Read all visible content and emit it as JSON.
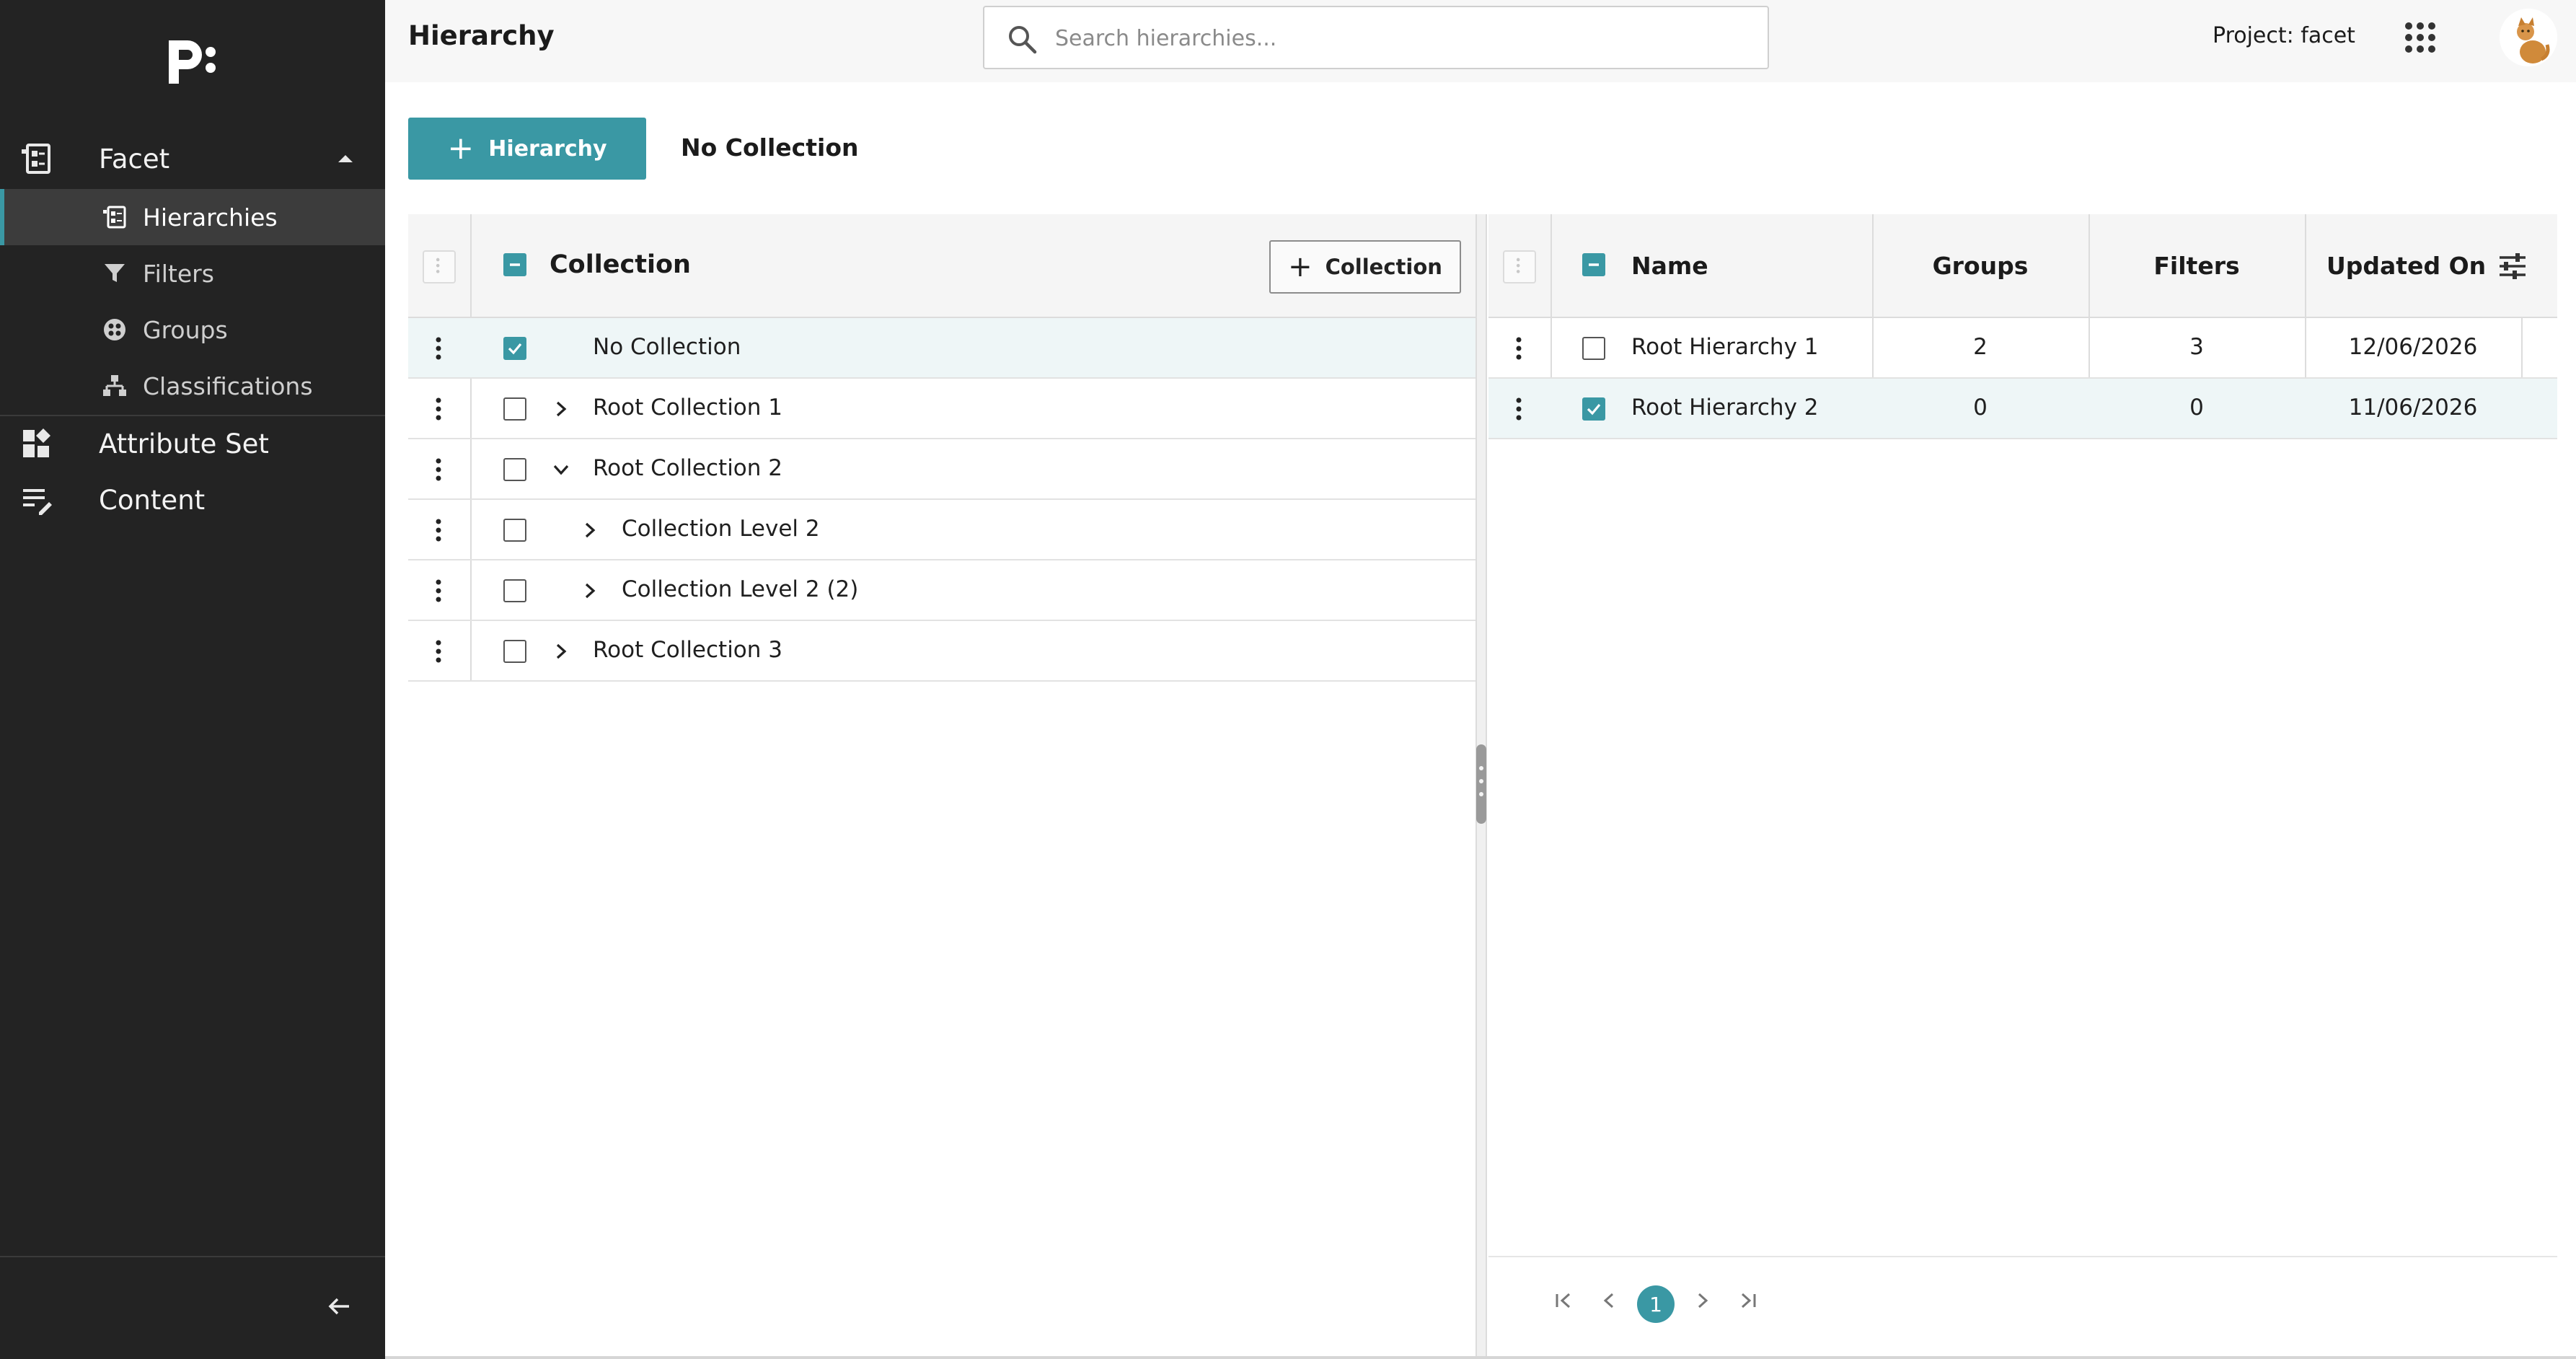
{
  "app": {
    "page_title": "Hierarchy",
    "project_label": "Project: facet",
    "accent_color": "#3a98a4"
  },
  "search": {
    "placeholder": "Search hierarchies..."
  },
  "sidebar": {
    "sections": [
      {
        "label": "Facet",
        "icon": "hierarchy-doc-icon",
        "expanded": true
      },
      {
        "label": "Attribute Set",
        "icon": "dashboard-add-icon"
      },
      {
        "label": "Content",
        "icon": "edit-list-icon"
      }
    ],
    "facet_items": [
      {
        "label": "Hierarchies",
        "icon": "hierarchy-doc-icon",
        "active": true
      },
      {
        "label": "Filters",
        "icon": "filter-icon"
      },
      {
        "label": "Groups",
        "icon": "groups-icon"
      },
      {
        "label": "Classifications",
        "icon": "classification-icon"
      }
    ]
  },
  "toolbar": {
    "add_hierarchy_label": "Hierarchy",
    "current_collection": "No Collection"
  },
  "collections": {
    "header": "Collection",
    "add_label": "Collection",
    "rows": [
      {
        "label": "No Collection",
        "checked": true,
        "expander": "none",
        "level": 0
      },
      {
        "label": "Root Collection 1",
        "checked": false,
        "expander": "collapsed",
        "level": 0
      },
      {
        "label": "Root Collection 2",
        "checked": false,
        "expander": "expanded",
        "level": 0
      },
      {
        "label": "Collection Level 2",
        "checked": false,
        "expander": "collapsed",
        "level": 1
      },
      {
        "label": "Collection Level 2 (2)",
        "checked": false,
        "expander": "collapsed",
        "level": 1
      },
      {
        "label": "Root Collection 3",
        "checked": false,
        "expander": "collapsed",
        "level": 0
      }
    ]
  },
  "hierarchies": {
    "columns": {
      "name": "Name",
      "groups": "Groups",
      "filters": "Filters",
      "updated_on": "Updated On"
    },
    "rows": [
      {
        "name": "Root Hierarchy 1",
        "groups": "2",
        "filters": "3",
        "updated_on": "12/06/2026",
        "checked": false
      },
      {
        "name": "Root Hierarchy 2",
        "groups": "0",
        "filters": "0",
        "updated_on": "11/06/2026",
        "checked": true
      }
    ],
    "pagination": {
      "current_page": "1"
    }
  }
}
